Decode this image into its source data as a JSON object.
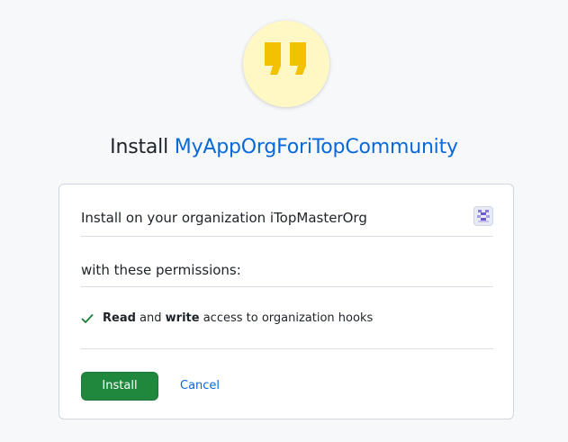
{
  "header": {
    "logo_icon": "quote-marks-icon",
    "logo_color": "#f2c200",
    "logo_bg": "#fff8c5",
    "title_prefix": "Install",
    "app_name": "MyAppOrgForiTopCommunity"
  },
  "install_card": {
    "org_label": "Install on your organization iTopMasterOrg",
    "org_avatar_icon": "org-avatar-icon",
    "permissions_heading": "with these permissions:",
    "permissions": [
      {
        "icon": "check-icon",
        "read": "Read",
        "and": "and",
        "write": "write",
        "rest": "access to organization hooks"
      }
    ],
    "install_button": "Install",
    "cancel_link": "Cancel"
  },
  "colors": {
    "accent_link": "#0969da",
    "install_button": "#1f883d",
    "check": "#1a7f37"
  }
}
